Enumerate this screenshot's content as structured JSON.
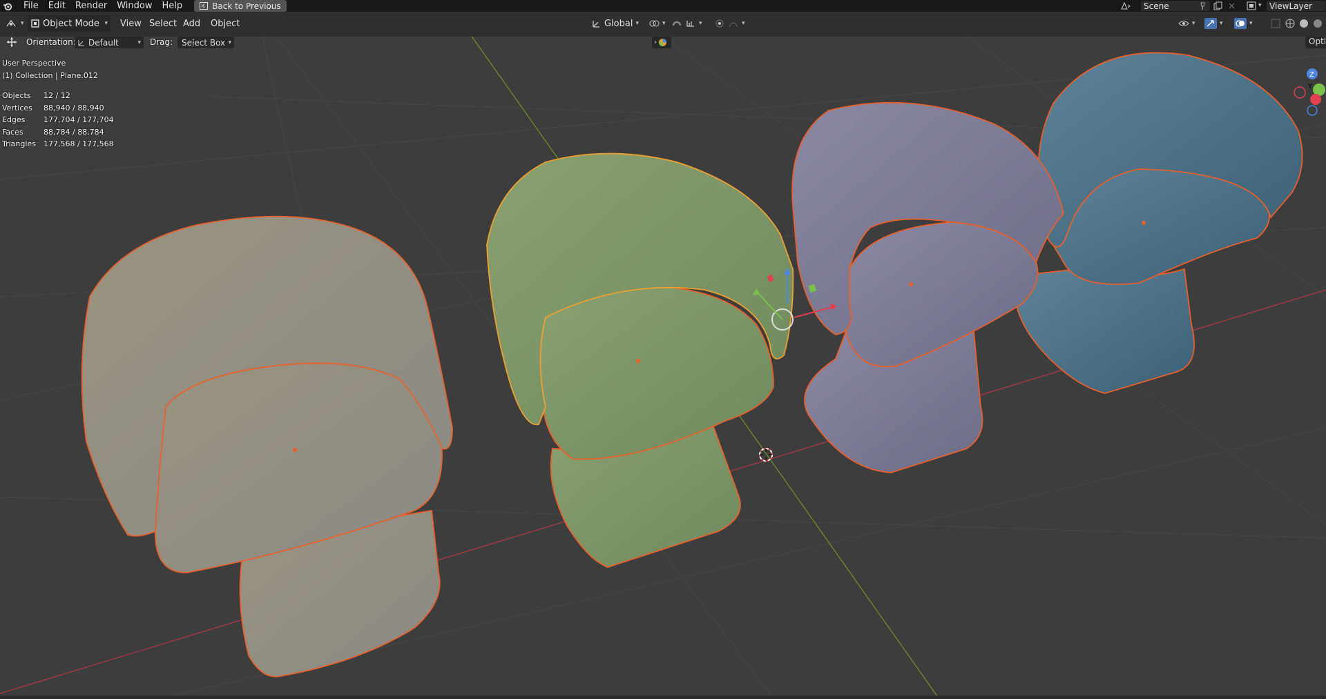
{
  "menu": {
    "items": [
      "File",
      "Edit",
      "Render",
      "Window",
      "Help"
    ],
    "back_label": "Back to Previous",
    "scene": "Scene",
    "view_layer": "ViewLayer"
  },
  "header": {
    "mode": "Object Mode",
    "menus": [
      "View",
      "Select",
      "Add",
      "Object"
    ],
    "transform_orientation": "Global"
  },
  "tool_settings": {
    "orientation_label": "Orientation:",
    "orientation_value": "Default",
    "drag_label": "Drag:",
    "drag_value": "Select Box",
    "options_label": "Opti"
  },
  "overlay": {
    "view_name": "User Perspective",
    "collection": "(1) Collection | Plane.012",
    "stats": [
      {
        "label": "Objects",
        "value": "12 / 12"
      },
      {
        "label": "Vertices",
        "value": "88,940 / 88,940"
      },
      {
        "label": "Edges",
        "value": "177,704 / 177,704"
      },
      {
        "label": "Faces",
        "value": "88,784 / 88,784"
      },
      {
        "label": "Triangles",
        "value": "177,568 / 177,568"
      }
    ]
  },
  "colors": {
    "selection_outline": "#e8602c",
    "active_outline": "#f0a030",
    "x_axis": "#a33a47",
    "y_axis": "#6a8a2a",
    "chair_beige": "#8e8a80",
    "chair_green": "#7a9468",
    "chair_lavender": "#7a7890",
    "chair_blue": "#4a7086"
  },
  "icons": [
    "blender-logo-icon",
    "editor-type-icon",
    "object-mode-icon",
    "transform-icon",
    "orientation-icon",
    "global-icon",
    "pivot-icon",
    "snap-icon",
    "proportional-icon",
    "visibility-icon",
    "gizmo-icon",
    "overlay-icon",
    "shading-icon",
    "navigation-gizmo-icon",
    "3d-cursor-icon"
  ]
}
